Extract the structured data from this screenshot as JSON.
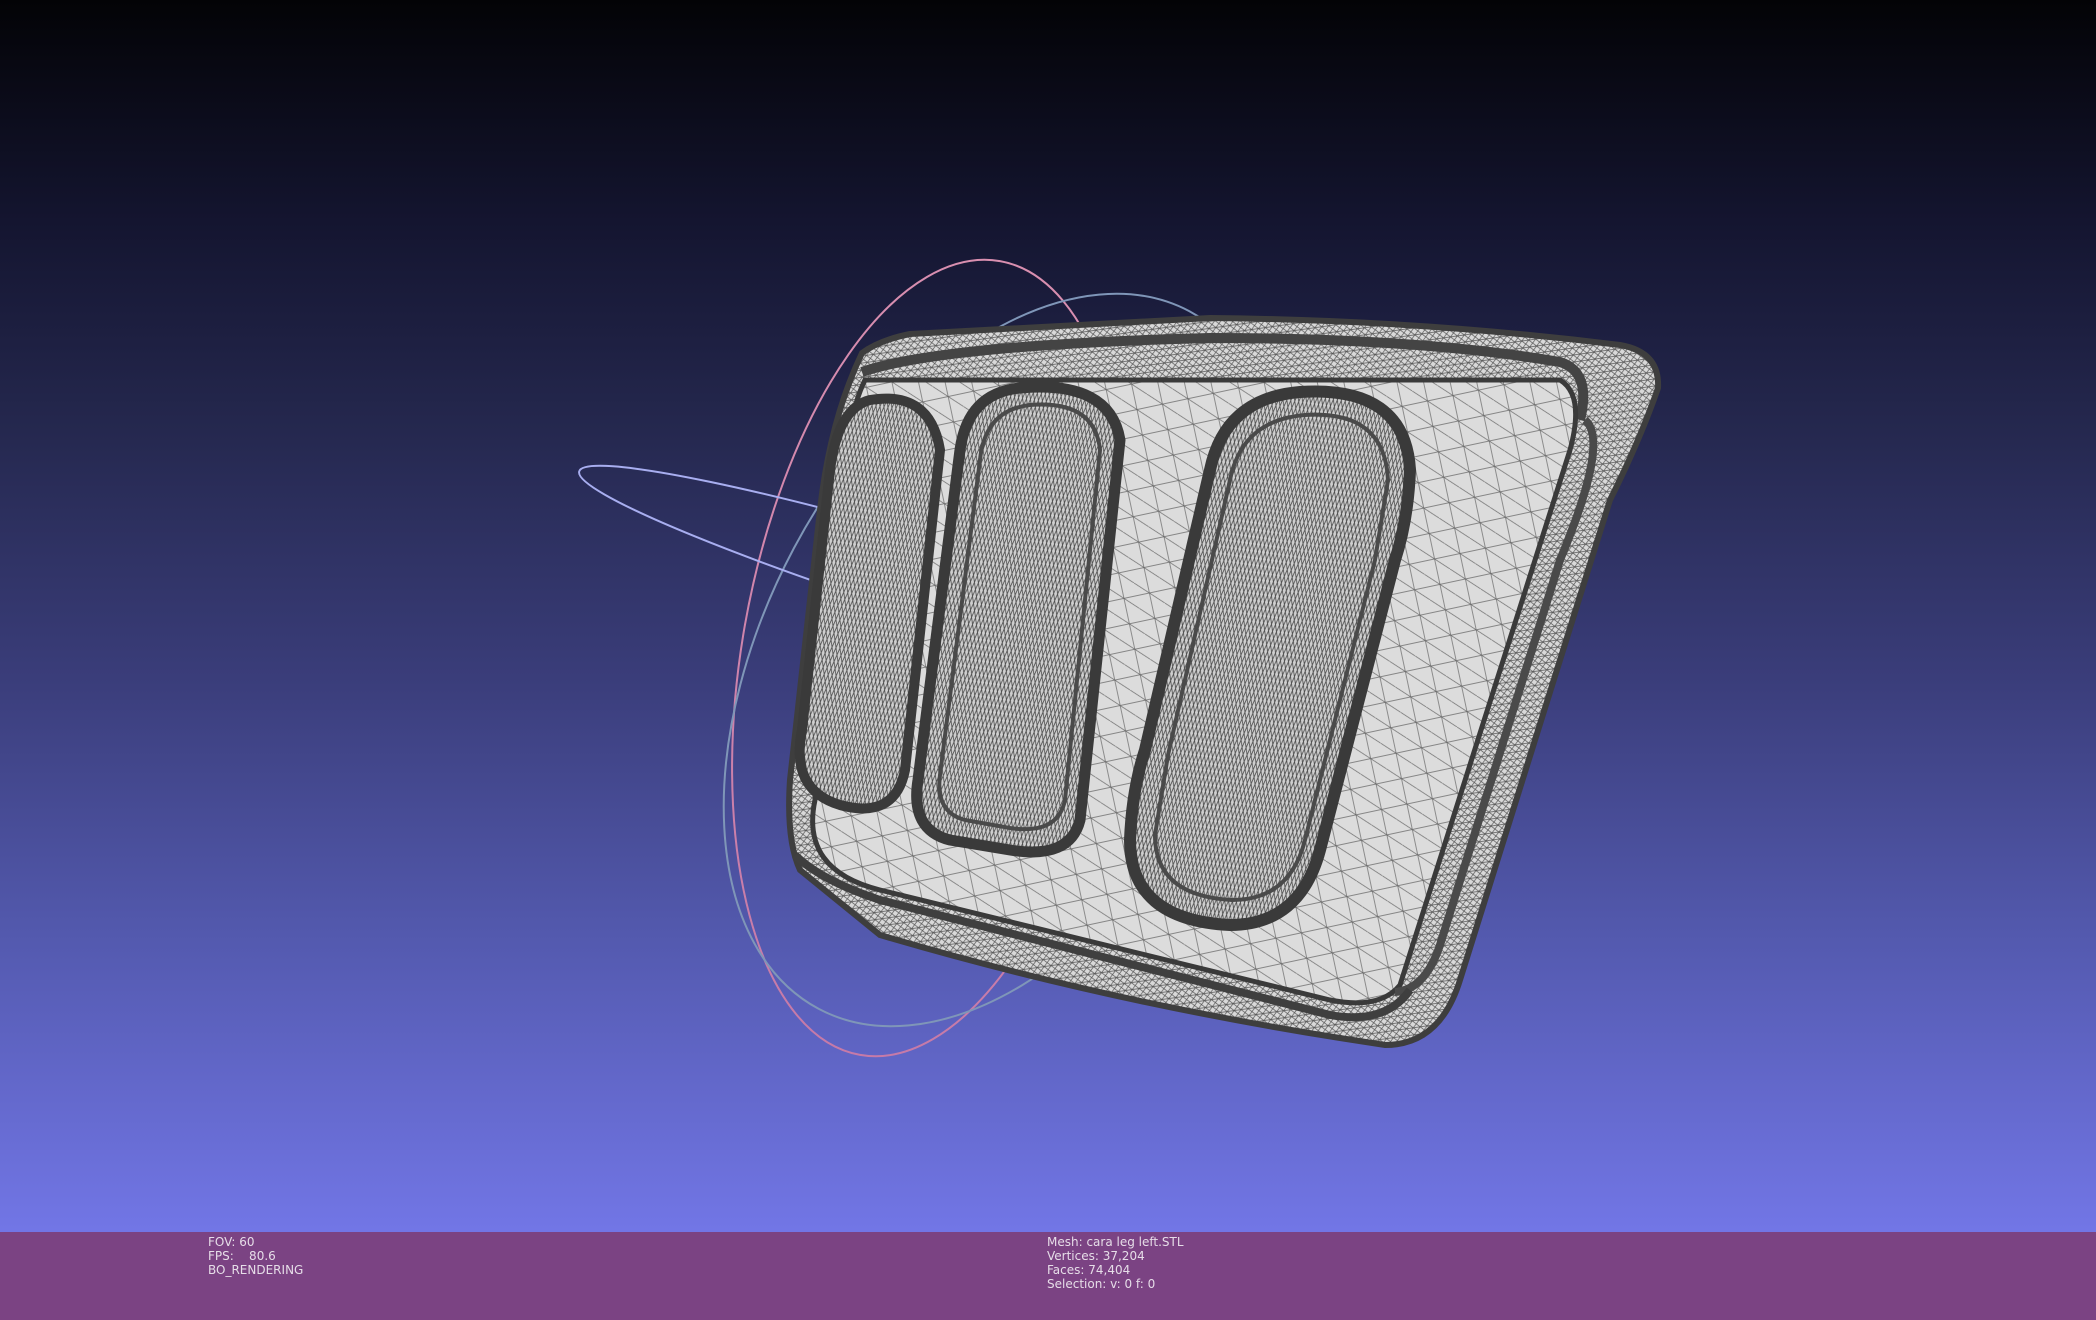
{
  "viewport": {
    "background_top": "#030306",
    "background_bottom": "#7276e6",
    "mesh_fill": "#d8d8d8",
    "mesh_wire": "#3e3e3e",
    "trackball_colors": [
      "#e08fb4",
      "#9aa0e8",
      "#8fb9c7"
    ]
  },
  "status_bar": {
    "background": "#7b4383",
    "fov": "FOV: 60",
    "fps": "FPS:    80.6",
    "render_mode": "BO_RENDERING",
    "mesh": "Mesh: cara leg left.STL",
    "vertices": "Vertices: 37,204",
    "faces": "Faces: 74,404",
    "selection": "Selection: v: 0 f: 0"
  }
}
